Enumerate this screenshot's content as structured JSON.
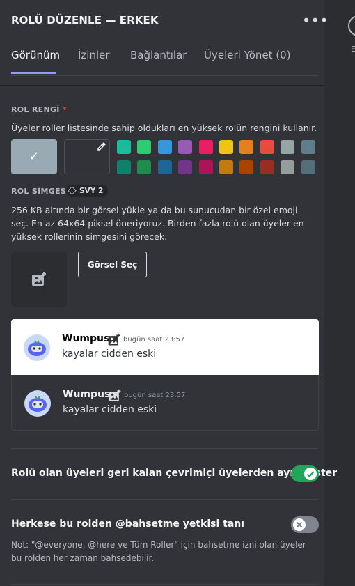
{
  "header": {
    "title": "ROLÜ DÜZENLE — ERKEK",
    "more_icon": "more-horizontal-icon"
  },
  "tabs": [
    {
      "label": "Görünüm",
      "active": true
    },
    {
      "label": "İzinler",
      "active": false
    },
    {
      "label": "Bağlantılar",
      "active": false
    },
    {
      "label": "Üyeleri Yönet (0)",
      "active": false
    }
  ],
  "role_color": {
    "label": "ROL RENGİ",
    "required_mark": "*",
    "description": "Üyeler roller listesinde sahip oldukları en yüksek rolün rengini kullanır.",
    "default_color": "#99aab5",
    "swatches_row1": [
      "#1abc9c",
      "#2ecc71",
      "#3498db",
      "#9b59b6",
      "#e91e63",
      "#f1c40f",
      "#e67e22",
      "#e74c3c",
      "#95a5a6",
      "#607d8b"
    ],
    "swatches_row2": [
      "#11806a",
      "#1f8b4c",
      "#206694",
      "#71368a",
      "#ad1457",
      "#c27c0e",
      "#a84300",
      "#992d22",
      "#979c9f",
      "#546e7a"
    ]
  },
  "role_icon": {
    "label": "ROL SİMGESİ",
    "badge": "SVY 2",
    "description": "256 KB altında bir görsel yükle ya da bu sunucudan bir özel emoji seç. En az 64x64 piksel öneriyoruz. Birden fazla rolü olan üyeler en yüksek rollerinin simgesini görecek.",
    "select_button": "Görsel Seç"
  },
  "preview": {
    "username": "Wumpus",
    "timestamp": "bugün saat 23:57",
    "message": "kayalar cidden eski"
  },
  "options": {
    "display_separately": {
      "label": "Rolü olan üyeleri geri kalan çevrimiçi üyelerden ayrı göster",
      "enabled": true
    },
    "allow_mention": {
      "label_pre": "Herkese bu rolden ",
      "label_mention": "@bahsetme",
      "label_post": " yetkisi tanı",
      "enabled": false,
      "note": "Not: \"@everyone, @here ve Tüm Roller\" için bahsetme izni olan üyeler bu rolden her zaman bahsedebilir."
    }
  },
  "colors": {
    "accent": "#949cf7",
    "toggle_on": "#23a559",
    "toggle_off": "#80848e",
    "danger": "#f23f43"
  }
}
